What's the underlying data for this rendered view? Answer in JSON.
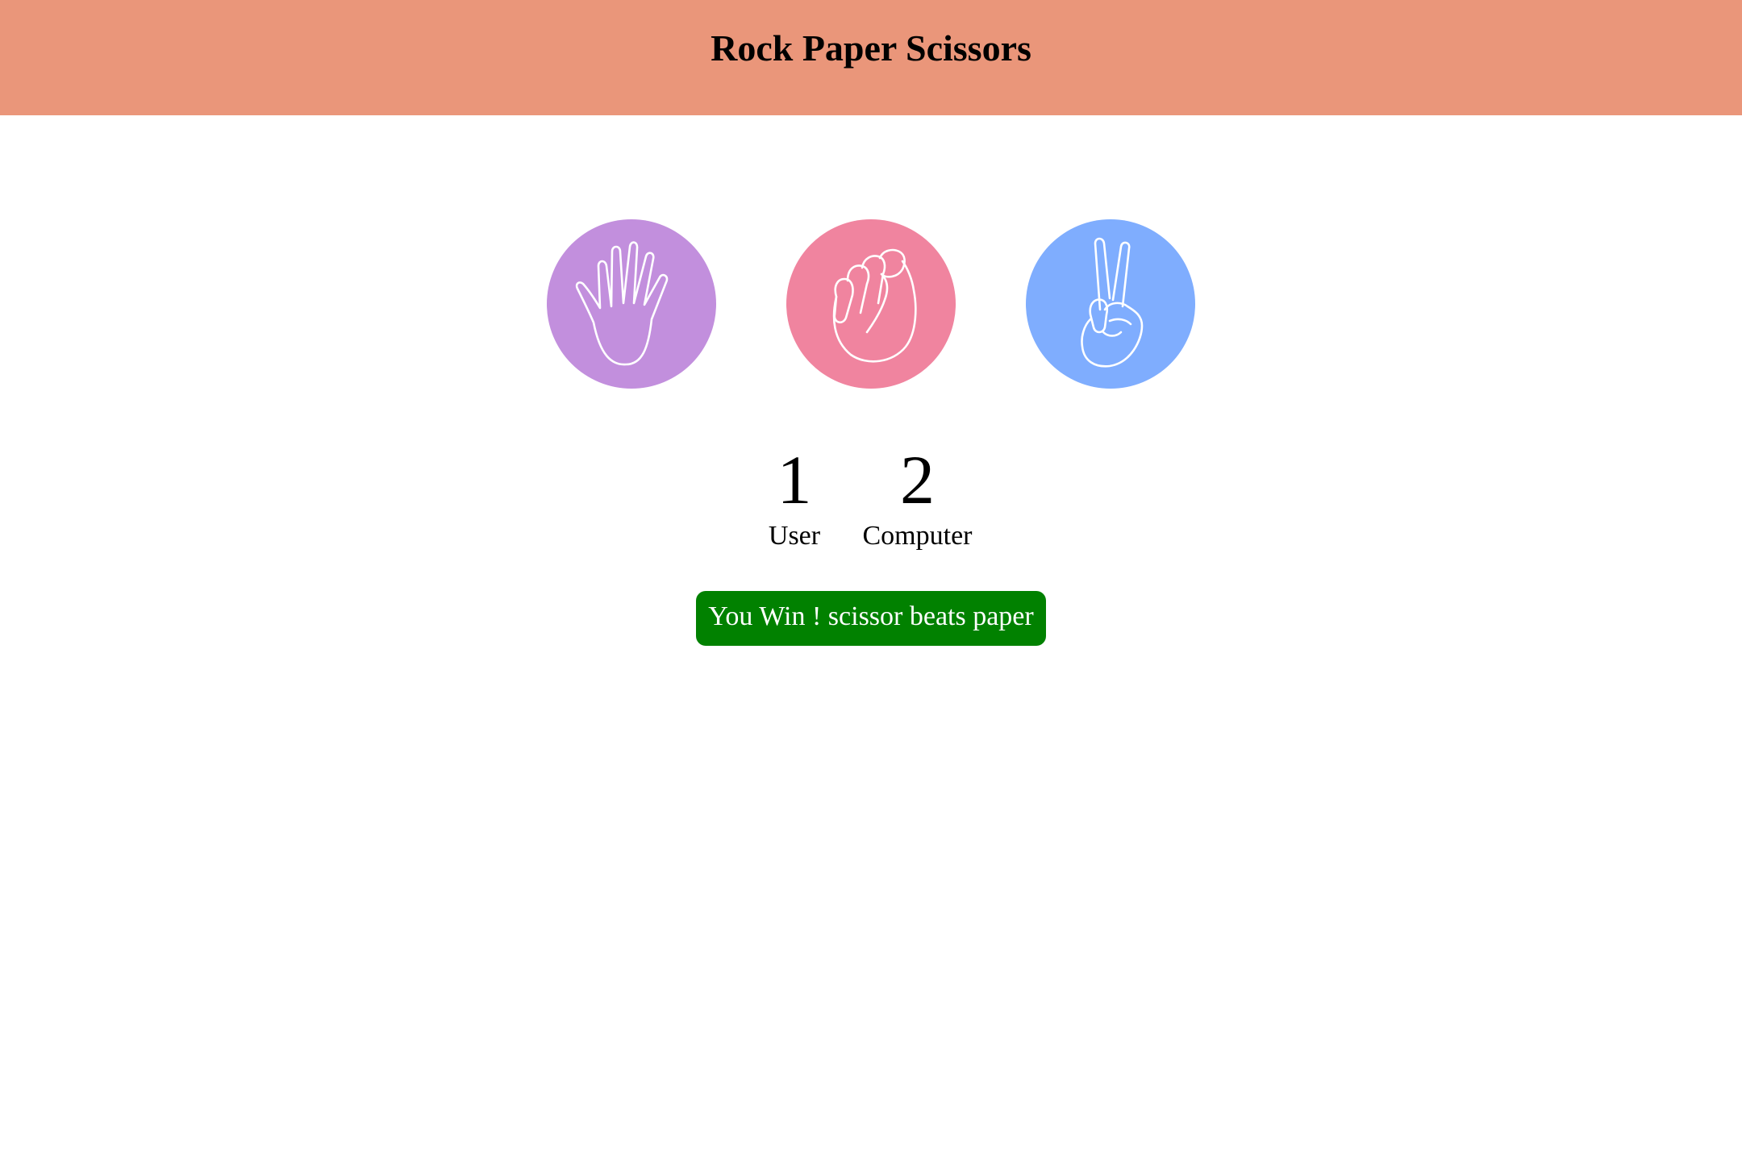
{
  "header": {
    "title": "Rock Paper Scissors",
    "background": "#ea967a"
  },
  "choices": [
    {
      "id": "paper",
      "icon": "open-hand-icon",
      "color": "#c28fdd"
    },
    {
      "id": "rock",
      "icon": "fist-icon",
      "color": "#f0849f"
    },
    {
      "id": "scissor",
      "icon": "peace-sign-icon",
      "color": "#7fadfe"
    }
  ],
  "scoreboard": {
    "user_score": "1",
    "user_label": "User",
    "computer_score": "2",
    "computer_label": "Computer"
  },
  "message": {
    "text": "You Win ! scissor beats paper",
    "background": "#018100",
    "color": "#ffffff"
  }
}
